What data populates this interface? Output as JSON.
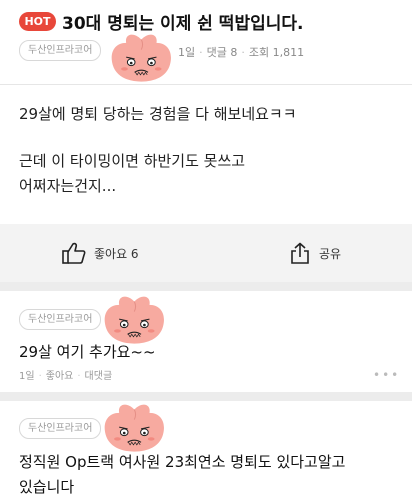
{
  "post": {
    "hot_label": "HOT",
    "title": "30대 명퇴는 이제 쉰 떡밥입니다.",
    "author_tag": "두산인프라코어",
    "meta": {
      "time": "1일",
      "comments": "댓글 8",
      "views": "조회 1,811"
    },
    "body_line1": "29살에 명퇴 당하는 경험을 다 해보네요ㅋㅋ",
    "body_line2": "근데 이 타이밍이면 하반기도 못쓰고",
    "body_line3": "어쩌자는건지..."
  },
  "actions": {
    "like_label": "좋아요 6",
    "share_label": "공유"
  },
  "comments": [
    {
      "author_tag": "두산인프라코어",
      "text": "29살 여기 추가요~~",
      "time": "1일",
      "like": "좋아요",
      "reply": "대댓글"
    },
    {
      "author_tag": "두산인프라코어",
      "line1": "정직원 Op트랙 여사원 23최연소 명퇴도 있다고알고",
      "line2": "있습니다"
    }
  ],
  "colors": {
    "hot": "#e8473a",
    "avatar": "#f7aaa0",
    "action_bar": "#f3f3f3"
  }
}
